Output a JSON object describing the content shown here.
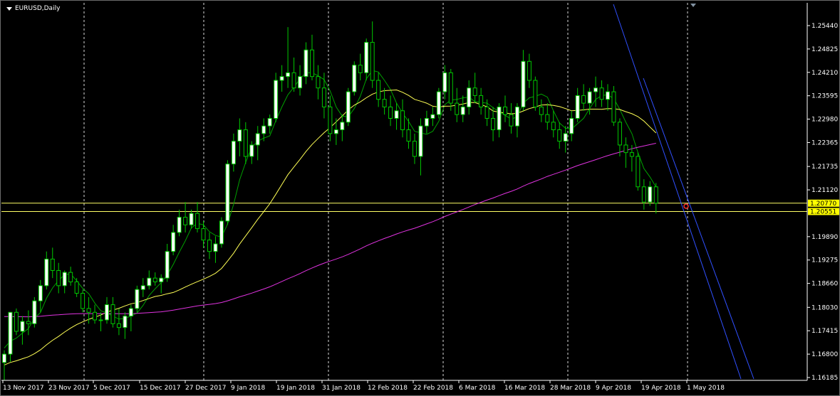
{
  "window": {
    "symbol_label": "EURUSD,Daily",
    "background": "#000000",
    "colors": {
      "bull_body": "#ffffff",
      "bear_body": "#000000",
      "candle_outline": "#00c800",
      "grid": "#ffffff",
      "hline": "#ffff66",
      "channel": "#3050ff",
      "ma_fast": "#00a000",
      "ma_mid": "#ffff55",
      "ma_slow": "#e033e0",
      "price_box": "#ffff00"
    }
  },
  "price_axis": {
    "ticks": [
      "1.25440",
      "1.24825",
      "1.24210",
      "1.23595",
      "1.22980",
      "1.22365",
      "1.21735",
      "1.21120",
      "1.19890",
      "1.19275",
      "1.18660",
      "1.18030",
      "1.17415",
      "1.16800",
      "1.16185"
    ],
    "price_labels": [
      "1.20770",
      "1.20551"
    ]
  },
  "time_axis": {
    "labels": [
      "13 Nov 2017",
      "23 Nov 2017",
      "5 Dec 2017",
      "15 Dec 2017",
      "27 Dec 2017",
      "9 Jan 2018",
      "19 Jan 2018",
      "31 Jan 2018",
      "12 Feb 2018",
      "22 Feb 2018",
      "6 Mar 2018",
      "16 Mar 2018",
      "28 Mar 2018",
      "9 Apr 2018",
      "19 Apr 2018",
      "1 May 2018"
    ]
  },
  "chart_data": {
    "type": "candlestick",
    "symbol": "EURUSD",
    "timeframe": "Daily",
    "ylim": [
      1.16185,
      1.2544
    ],
    "horizontal_lines": [
      1.2077,
      1.20551
    ],
    "grid": "vertical dashed at time labels",
    "candles": [
      [
        1.1658,
        1.169,
        1.161,
        1.168
      ],
      [
        1.168,
        1.177,
        1.166,
        1.179
      ],
      [
        1.179,
        1.18,
        1.173,
        1.174
      ],
      [
        1.174,
        1.178,
        1.1705,
        1.1766
      ],
      [
        1.1766,
        1.1795,
        1.173,
        1.176
      ],
      [
        1.176,
        1.183,
        1.175,
        1.182
      ],
      [
        1.182,
        1.1875,
        1.179,
        1.186
      ],
      [
        1.186,
        1.195,
        1.185,
        1.193
      ],
      [
        1.193,
        1.196,
        1.188,
        1.19
      ],
      [
        1.19,
        1.192,
        1.184,
        1.186
      ],
      [
        1.186,
        1.19,
        1.184,
        1.1895
      ],
      [
        1.1895,
        1.191,
        1.186,
        1.187
      ],
      [
        1.187,
        1.188,
        1.183,
        1.184
      ],
      [
        1.184,
        1.185,
        1.179,
        1.18
      ],
      [
        1.18,
        1.183,
        1.176,
        1.179
      ],
      [
        1.179,
        1.181,
        1.176,
        1.177
      ],
      [
        1.177,
        1.179,
        1.174,
        1.177
      ],
      [
        1.177,
        1.183,
        1.176,
        1.181
      ],
      [
        1.181,
        1.183,
        1.175,
        1.176
      ],
      [
        1.176,
        1.18,
        1.173,
        1.175
      ],
      [
        1.175,
        1.179,
        1.172,
        1.178
      ],
      [
        1.178,
        1.181,
        1.174,
        1.18
      ],
      [
        1.18,
        1.186,
        1.179,
        1.185
      ],
      [
        1.185,
        1.188,
        1.183,
        1.186
      ],
      [
        1.186,
        1.19,
        1.185,
        1.188
      ],
      [
        1.188,
        1.1895,
        1.186,
        1.187
      ],
      [
        1.187,
        1.189,
        1.184,
        1.188
      ],
      [
        1.188,
        1.197,
        1.187,
        1.195
      ],
      [
        1.195,
        1.202,
        1.194,
        1.2
      ],
      [
        1.2,
        1.206,
        1.199,
        1.204
      ],
      [
        1.204,
        1.208,
        1.2,
        1.202
      ],
      [
        1.202,
        1.206,
        1.201,
        1.205
      ],
      [
        1.205,
        1.208,
        1.2,
        1.201
      ],
      [
        1.201,
        1.203,
        1.196,
        1.198
      ],
      [
        1.198,
        1.2,
        1.193,
        1.195
      ],
      [
        1.195,
        1.199,
        1.192,
        1.197
      ],
      [
        1.197,
        1.204,
        1.196,
        1.203
      ],
      [
        1.203,
        1.219,
        1.202,
        1.218
      ],
      [
        1.218,
        1.226,
        1.216,
        1.224
      ],
      [
        1.224,
        1.23,
        1.22,
        1.227
      ],
      [
        1.227,
        1.229,
        1.218,
        1.22
      ],
      [
        1.22,
        1.224,
        1.218,
        1.223
      ],
      [
        1.223,
        1.228,
        1.219,
        1.226
      ],
      [
        1.226,
        1.23,
        1.224,
        1.228
      ],
      [
        1.228,
        1.231,
        1.226,
        1.23
      ],
      [
        1.23,
        1.242,
        1.229,
        1.24
      ],
      [
        1.24,
        1.244,
        1.237,
        1.241
      ],
      [
        1.241,
        1.254,
        1.238,
        1.242
      ],
      [
        1.242,
        1.246,
        1.237,
        1.238
      ],
      [
        1.238,
        1.244,
        1.236,
        1.241
      ],
      [
        1.241,
        1.25,
        1.239,
        1.248
      ],
      [
        1.248,
        1.252,
        1.24,
        1.241
      ],
      [
        1.241,
        1.244,
        1.235,
        1.238
      ],
      [
        1.238,
        1.242,
        1.23,
        1.233
      ],
      [
        1.233,
        1.236,
        1.224,
        1.226
      ],
      [
        1.226,
        1.23,
        1.223,
        1.227
      ],
      [
        1.227,
        1.231,
        1.224,
        1.229
      ],
      [
        1.229,
        1.238,
        1.228,
        1.237
      ],
      [
        1.237,
        1.245,
        1.236,
        1.244
      ],
      [
        1.244,
        1.247,
        1.24,
        1.242
      ],
      [
        1.242,
        1.251,
        1.24,
        1.25
      ],
      [
        1.25,
        1.2555,
        1.238,
        1.24
      ],
      [
        1.24,
        1.242,
        1.233,
        1.235
      ],
      [
        1.235,
        1.238,
        1.231,
        1.233
      ],
      [
        1.233,
        1.236,
        1.228,
        1.23
      ],
      [
        1.23,
        1.234,
        1.227,
        1.232
      ],
      [
        1.232,
        1.235,
        1.225,
        1.227
      ],
      [
        1.227,
        1.23,
        1.222,
        1.224
      ],
      [
        1.224,
        1.226,
        1.218,
        1.22
      ],
      [
        1.22,
        1.23,
        1.215,
        1.228
      ],
      [
        1.228,
        1.232,
        1.226,
        1.23
      ],
      [
        1.23,
        1.233,
        1.228,
        1.231
      ],
      [
        1.231,
        1.238,
        1.23,
        1.237
      ],
      [
        1.237,
        1.244,
        1.235,
        1.242
      ],
      [
        1.242,
        1.243,
        1.232,
        1.234
      ],
      [
        1.234,
        1.238,
        1.229,
        1.231
      ],
      [
        1.231,
        1.236,
        1.229,
        1.233
      ],
      [
        1.233,
        1.24,
        1.231,
        1.238
      ],
      [
        1.238,
        1.242,
        1.234,
        1.236
      ],
      [
        1.236,
        1.238,
        1.231,
        1.233
      ],
      [
        1.233,
        1.235,
        1.228,
        1.23
      ],
      [
        1.23,
        1.233,
        1.224,
        1.227
      ],
      [
        1.227,
        1.234,
        1.225,
        1.233
      ],
      [
        1.233,
        1.236,
        1.229,
        1.231
      ],
      [
        1.231,
        1.234,
        1.226,
        1.228
      ],
      [
        1.228,
        1.234,
        1.225,
        1.233
      ],
      [
        1.233,
        1.248,
        1.232,
        1.245
      ],
      [
        1.245,
        1.247,
        1.238,
        1.24
      ],
      [
        1.24,
        1.241,
        1.232,
        1.233
      ],
      [
        1.233,
        1.235,
        1.229,
        1.231
      ],
      [
        1.231,
        1.234,
        1.227,
        1.229
      ],
      [
        1.229,
        1.232,
        1.225,
        1.227
      ],
      [
        1.227,
        1.229,
        1.222,
        1.224
      ],
      [
        1.224,
        1.228,
        1.221,
        1.226
      ],
      [
        1.226,
        1.232,
        1.224,
        1.23
      ],
      [
        1.23,
        1.238,
        1.229,
        1.236
      ],
      [
        1.236,
        1.239,
        1.232,
        1.234
      ],
      [
        1.234,
        1.238,
        1.231,
        1.237
      ],
      [
        1.237,
        1.241,
        1.233,
        1.238
      ],
      [
        1.238,
        1.24,
        1.233,
        1.235
      ],
      [
        1.235,
        1.239,
        1.232,
        1.237
      ],
      [
        1.237,
        1.2385,
        1.228,
        1.229
      ],
      [
        1.229,
        1.23,
        1.22,
        1.223
      ],
      [
        1.223,
        1.225,
        1.217,
        1.221
      ],
      [
        1.221,
        1.223,
        1.216,
        1.22
      ],
      [
        1.22,
        1.221,
        1.211,
        1.212
      ],
      [
        1.212,
        1.214,
        1.206,
        1.208
      ],
      [
        1.208,
        1.2135,
        1.207,
        1.212
      ],
      [
        1.212,
        1.213,
        1.205,
        1.2077
      ]
    ]
  }
}
